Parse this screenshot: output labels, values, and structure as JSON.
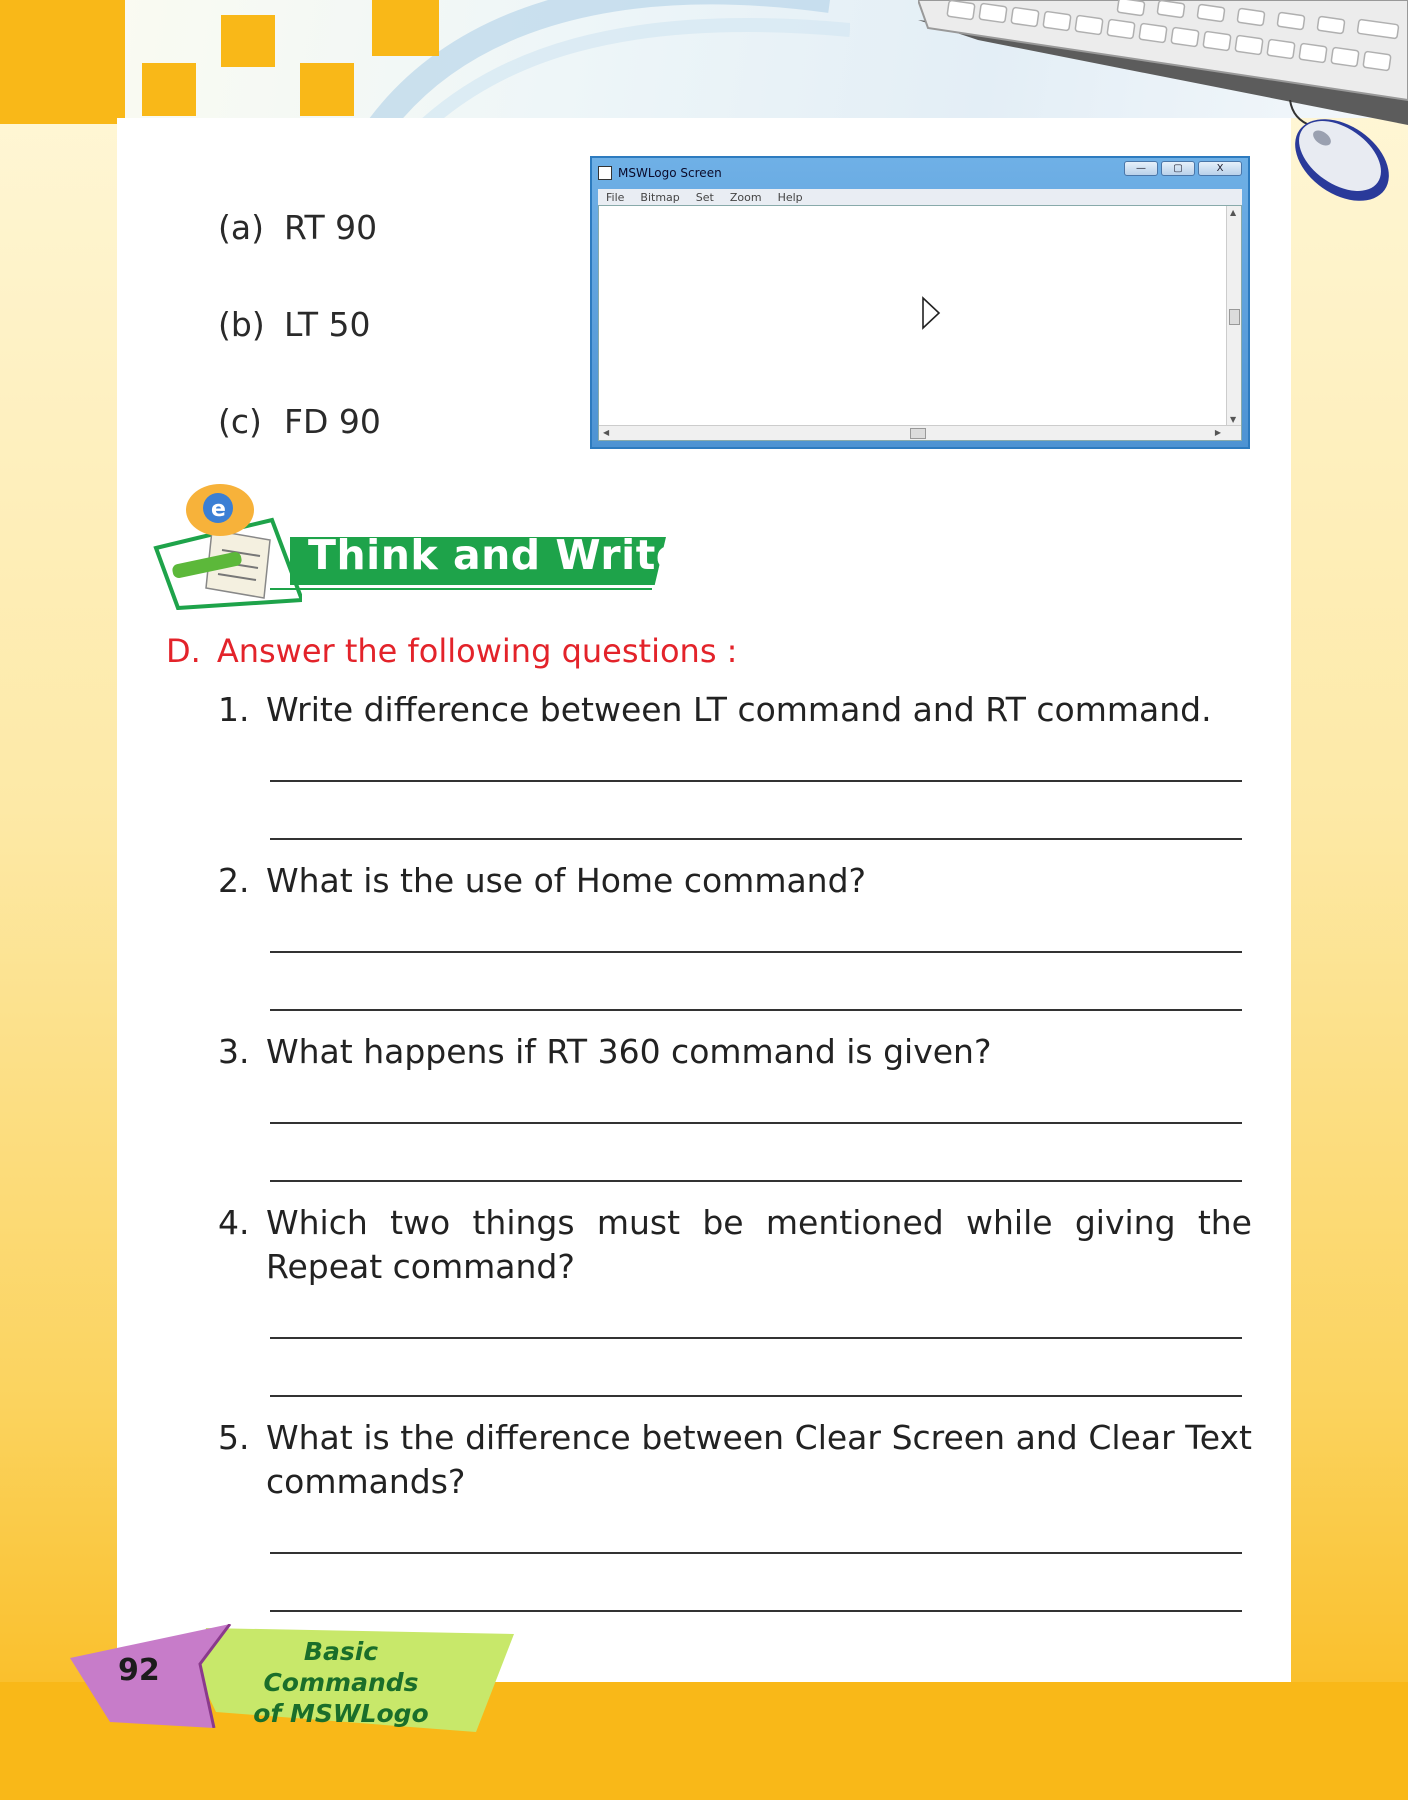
{
  "options": [
    {
      "tag": "(a)",
      "text": "RT 90"
    },
    {
      "tag": "(b)",
      "text": "LT 50"
    },
    {
      "tag": "(c)",
      "text": "FD 90"
    }
  ],
  "logo_window": {
    "title": "MSWLogo Screen",
    "menu": [
      "File",
      "Bitmap",
      "Set",
      "Zoom",
      "Help"
    ],
    "controls": {
      "minimize": "—",
      "maximize": "▢",
      "close": "X"
    }
  },
  "think_write": {
    "title": "Think and Write"
  },
  "section": {
    "label": "D.",
    "heading": "Answer the following questions :"
  },
  "questions": [
    {
      "num": "1.",
      "text": "Write difference between LT command and RT command."
    },
    {
      "num": "2.",
      "text": "What is the use of Home command?"
    },
    {
      "num": "3.",
      "text": "What happens if RT 360 command is given?"
    },
    {
      "num": "4.",
      "text": "Which two things must be mentioned while giving the Repeat command?"
    },
    {
      "num": "5.",
      "text": "What is the difference between Clear Screen and Clear Text commands?"
    }
  ],
  "footer": {
    "page_number": "92",
    "chapter_line1": "Basic Commands",
    "chapter_line2": "of MSWLogo"
  },
  "colors": {
    "accent_orange": "#f9b818",
    "heading_red": "#e3232a",
    "banner_green": "#1ea34a",
    "footer_green": "#c8e86a",
    "footer_purple": "#c77cc9"
  }
}
